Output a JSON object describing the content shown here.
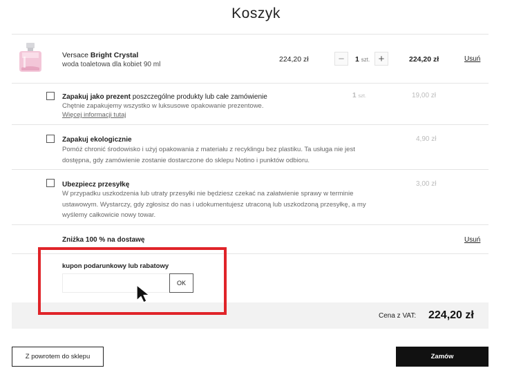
{
  "page": {
    "title": "Koszyk"
  },
  "product": {
    "brand": "Versace",
    "name": "Bright Crystal",
    "description": "woda toaletowa dla kobiet 90 ml",
    "price": "224,20 zł",
    "minus": "−",
    "quantity": "1",
    "unit": "szt.",
    "plus": "+",
    "total": "224,20 zł",
    "remove": "Usuń"
  },
  "options": {
    "gift": {
      "title_bold": "Zapakuj jako prezent",
      "title_rest": " poszczególne produkty lub całe zamówienie",
      "desc": "Chętnie zapakujemy wszystko w luksusowe opakowanie prezentowe.",
      "link": "Więcej informacji tutaj",
      "quantity": "1",
      "unit": "szt.",
      "price": "19,00 zł"
    },
    "eco": {
      "title": "Zapakuj ekologicznie",
      "desc_line1": "Pomóż chronić środowisko i użyj opakowania z materiału z recyklingu bez plastiku. Ta usługa nie jest",
      "desc_line2": "dostępna, gdy zamówienie zostanie dostarczone do sklepu Notino i punktów odbioru.",
      "price": "4,90 zł"
    },
    "insurance": {
      "title": "Ubezpiecz przesyłkę",
      "desc_line1": "W przypadku uszkodzenia lub utraty przesyłki nie będziesz czekać na załatwienie sprawy w terminie",
      "desc_line2": "ustawowym. Wystarczy, gdy zgłosisz do nas i udokumentujesz utraconą lub uszkodzoną przesyłkę, a my",
      "desc_line3": "wyślemy całkowicie nowy towar.",
      "price": "3,00 zł"
    }
  },
  "discount": {
    "label": "Zniżka 100 % na dostawę",
    "remove": "Usuń"
  },
  "coupon": {
    "label": "kupon podarunkowy lub rabatowy",
    "value": "",
    "ok": "OK"
  },
  "summary": {
    "vat_label": "Cena z VAT:",
    "total": "224,20 zł"
  },
  "footer": {
    "back": "Z powrotem do sklepu",
    "order": "Zamów"
  },
  "colors": {
    "highlight": "#e02429",
    "order_button": "#111111",
    "summary_bar": "#f2f2f2"
  }
}
